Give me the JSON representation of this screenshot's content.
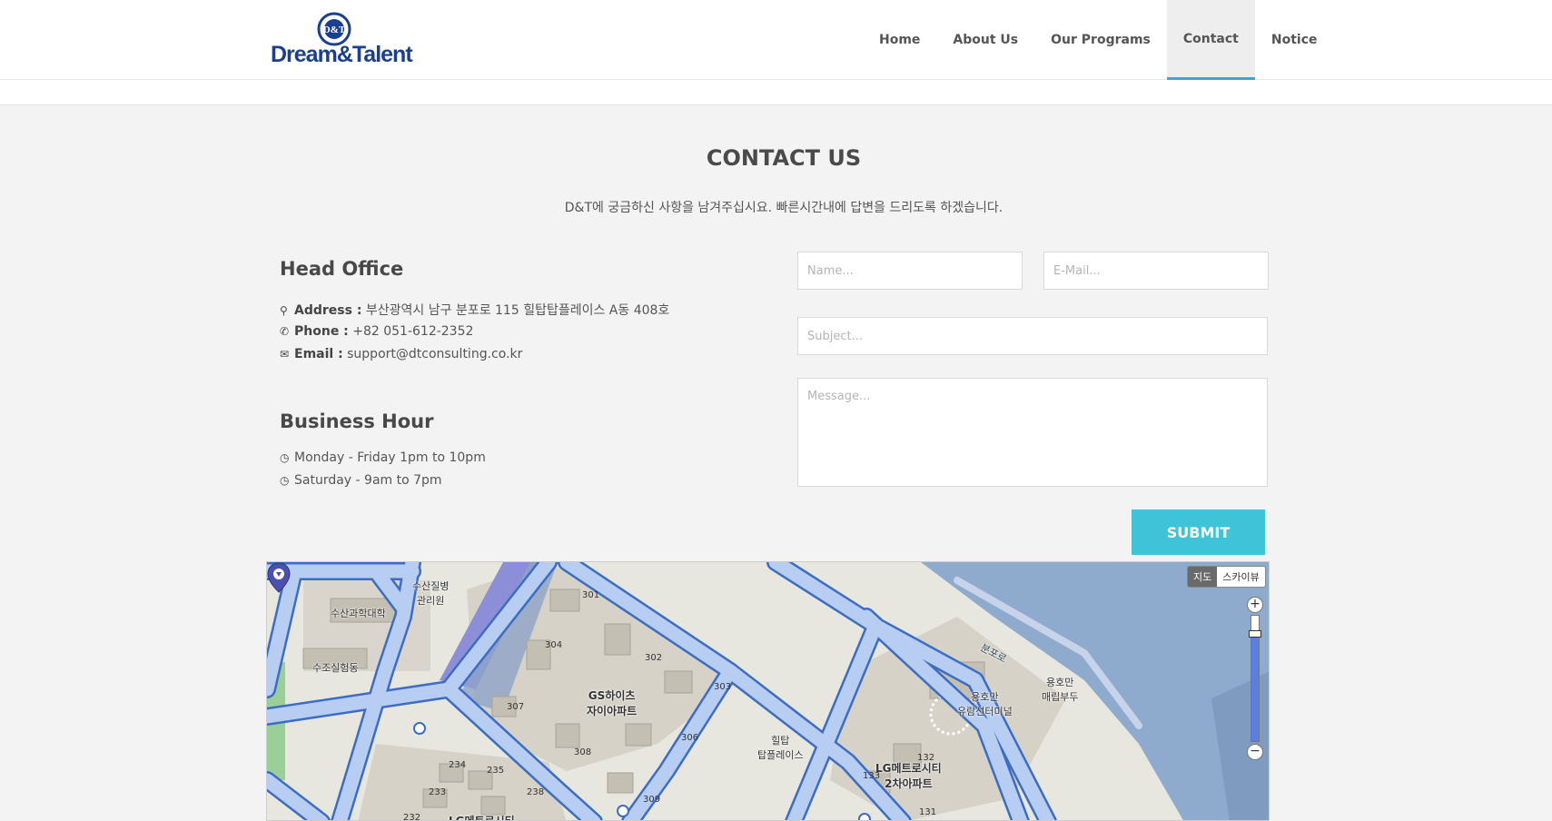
{
  "logo": {
    "text": "Dream&Talent",
    "emblem": "D&T"
  },
  "nav": [
    {
      "label": "Home",
      "active": false
    },
    {
      "label": "About Us",
      "active": false
    },
    {
      "label": "Our Programs",
      "active": false
    },
    {
      "label": "Contact",
      "active": true
    },
    {
      "label": "Notice",
      "active": false
    }
  ],
  "contact": {
    "title": "CONTACT US",
    "subtitle": "D&T에 궁금하신 사항을 남겨주십시요. 빠른시간내에 답변을 드리도록 하겠습니다."
  },
  "office": {
    "heading": "Head Office",
    "address_label": "Address :",
    "address": "부산광역시 남구 분포로 115 힐탑탑플레이스 A동 408호",
    "phone_label": "Phone :",
    "phone": "+82 051-612-2352",
    "email_label": "Email :",
    "email": "support@dtconsulting.co.kr"
  },
  "hours": {
    "heading": "Business Hour",
    "weekday": "Monday - Friday 1pm to 10pm",
    "saturday": "Saturday - 9am to 7pm"
  },
  "form": {
    "name_placeholder": "Name...",
    "email_placeholder": "E-Mail...",
    "subject_placeholder": "Subject...",
    "message_placeholder": "Message...",
    "submit_label": "SUBMIT"
  },
  "map": {
    "type_map": "지도",
    "type_sky": "스카이뷰",
    "zoom_in": "+",
    "zoom_out": "−",
    "zoom_level": 0.85,
    "labels": {
      "hospital": "수산질병\n관리원",
      "univ": "수산과학대학",
      "lab": "수조실험동",
      "gs_apt": "GS하이츠\n자이아파트",
      "hilltop": "힐탑\n탑플레이스",
      "terminal": "용호만\n유람선터미널",
      "pier": "용호만\n매립부두",
      "lg_metro2": "LG메트로시티\n2차아파트",
      "lg_metro": "LG메트로시티",
      "road": "분포로"
    },
    "numbers": [
      "301",
      "304",
      "302",
      "303",
      "307",
      "306",
      "308",
      "309",
      "234",
      "235",
      "233",
      "238",
      "132",
      "133",
      "131",
      "232"
    ]
  },
  "colors": {
    "accent": "#3aa7d2",
    "submit": "#3ec3d9",
    "logo": "#1b3f8f",
    "road": "#b8cdf2",
    "road_edge": "#3b6dc4",
    "water": "#8eaacd"
  },
  "icons": {
    "address": "map-marker-icon",
    "phone": "phone-icon",
    "email": "envelope-icon",
    "clock": "clock-icon"
  }
}
